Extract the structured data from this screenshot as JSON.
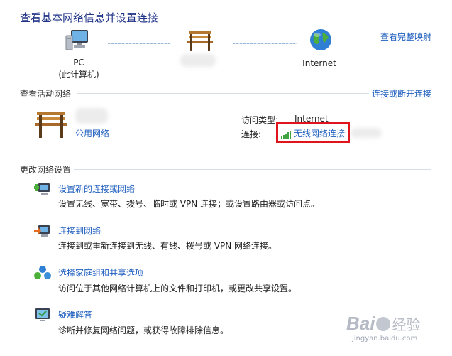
{
  "header": {
    "title": "查看基本网络信息并设置连接",
    "full_map_link": "查看完整映射"
  },
  "network_map": {
    "pc_label": "PC",
    "pc_sublabel": "(此计算机)",
    "internet_label": "Internet"
  },
  "active": {
    "section_title": "查看活动网络",
    "connect_link": "连接或断开连接",
    "network_type": "公用网络",
    "access_label": "访问类型:",
    "access_value": "Internet",
    "connection_label": "连接:",
    "connection_value": "无线网络连接"
  },
  "settings": {
    "section_title": "更改网络设置",
    "tasks": [
      {
        "title": "设置新的连接或网络",
        "desc": "设置无线、宽带、拨号、临时或 VPN 连接；或设置路由器或访问点。",
        "icon": "new-connection-icon"
      },
      {
        "title": "连接到网络",
        "desc": "连接到或重新连接到无线、有线、拨号或 VPN 网络连接。",
        "icon": "connect-network-icon"
      },
      {
        "title": "选择家庭组和共享选项",
        "desc": "访问位于其他网络计算机上的文件和打印机，或更改共享设置。",
        "icon": "homegroup-icon"
      },
      {
        "title": "疑难解答",
        "desc": "诊断并修复网络问题，或获得故障排除信息。",
        "icon": "troubleshoot-icon"
      }
    ]
  },
  "watermark": {
    "brand": "Bai",
    "brand_cn": "经验",
    "url": "jingyan.baidu.com"
  },
  "colors": {
    "link": "#1f5fbf",
    "title": "#1e3287",
    "highlight": "#e0151c"
  }
}
